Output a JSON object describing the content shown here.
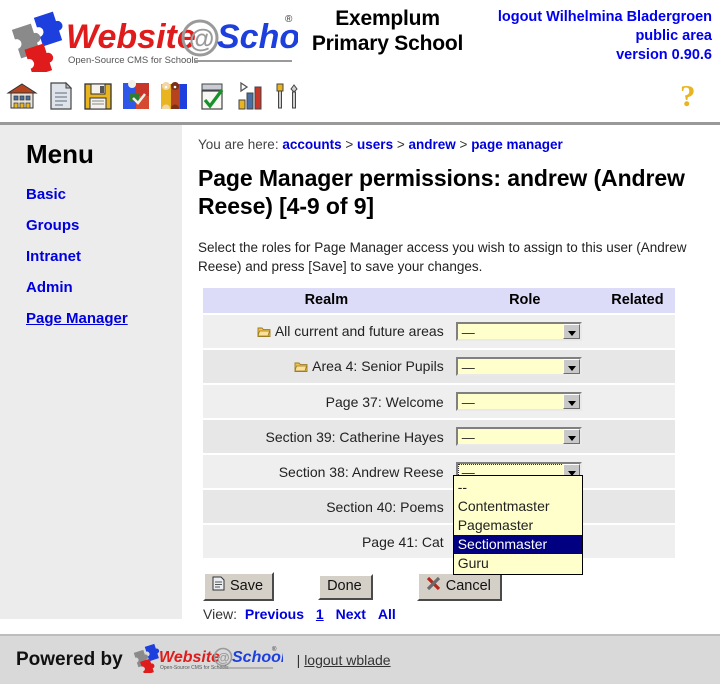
{
  "header": {
    "logo_alt": "Website@School",
    "logo_tagline": "Open-Source CMS for Schools",
    "school_name_line1": "Exemplum",
    "school_name_line2": "Primary School",
    "session_logout": "logout Wilhelmina Bladergroen",
    "session_area": "public area",
    "session_version": "version 0.90.6"
  },
  "toolbar": {
    "icons": [
      {
        "name": "school-home-icon",
        "title": "Home"
      },
      {
        "name": "file-document-icon",
        "title": "Pages"
      },
      {
        "name": "floppy-disk-icon",
        "title": "Save"
      },
      {
        "name": "puzzle-modules-icon",
        "title": "Modules"
      },
      {
        "name": "people-accounts-icon",
        "title": "Accounts"
      },
      {
        "name": "checklist-icon",
        "title": "Tasks"
      },
      {
        "name": "bar-chart-icon",
        "title": "Statistics"
      },
      {
        "name": "tools-icon",
        "title": "Tools"
      }
    ],
    "help_icon": "?"
  },
  "sidebar": {
    "title": "Menu",
    "items": [
      {
        "label": "Basic",
        "active": false
      },
      {
        "label": "Groups",
        "active": false
      },
      {
        "label": "Intranet",
        "active": false
      },
      {
        "label": "Admin",
        "active": false
      },
      {
        "label": "Page Manager",
        "active": true
      }
    ]
  },
  "breadcrumb": {
    "label": "You are here:",
    "items": [
      "accounts",
      "users",
      "andrew",
      "page manager"
    ],
    "separator": ">"
  },
  "main": {
    "title": "Page Manager permissions: andrew (Andrew Reese) [4-9 of 9]",
    "intro": "Select the roles for Page Manager access you wish to assign to this user (Andrew Reese) and press [Save] to save your changes."
  },
  "table": {
    "columns": [
      "Realm",
      "Role",
      "Related"
    ],
    "rows": [
      {
        "realm": "All current and future areas",
        "icon": "folder-icon",
        "indent": 0,
        "role": "—",
        "related": ""
      },
      {
        "realm": "Area 4: Senior Pupils",
        "icon": "folder-icon",
        "indent": 0,
        "role": "—",
        "related": ""
      },
      {
        "realm": "Page 37: Welcome",
        "icon": "",
        "indent": 1,
        "role": "—",
        "related": ""
      },
      {
        "realm": "Section 39: Catherine Hayes",
        "icon": "",
        "indent": 1,
        "role": "—",
        "related": ""
      },
      {
        "realm": "Section 38: Andrew Reese",
        "icon": "",
        "indent": 1,
        "role": "—",
        "related": "",
        "open": true
      },
      {
        "realm": "Section 40: Poems",
        "icon": "",
        "indent": 2,
        "role": "",
        "related": ""
      },
      {
        "realm": "Page 41: Cat",
        "icon": "",
        "indent": 2,
        "role": "",
        "related": ""
      }
    ]
  },
  "dropdown": {
    "options": [
      "--",
      "Contentmaster",
      "Pagemaster",
      "Sectionmaster",
      "Guru"
    ],
    "selected": "Sectionmaster",
    "highlight_color": "#000080",
    "background_color": "#ffffcc"
  },
  "buttons": {
    "save": "Save",
    "done": "Done",
    "cancel": "Cancel"
  },
  "pagination": {
    "label": "View:",
    "previous": "Previous",
    "page": "1",
    "next": "Next",
    "all": "All"
  },
  "footer": {
    "powered_by": "Powered by",
    "logo_alt": "Website@School",
    "separator": "|",
    "logout_link": "logout wblade"
  },
  "colors": {
    "link": "#0000dd",
    "table_header_bg": "#dcdcf8",
    "row_odd_bg": "#e7e7e7",
    "row_even_bg": "#efefef",
    "select_bg": "#ffffcc",
    "help_icon": "#e8b521",
    "footer_bg": "#d9d9d9"
  }
}
